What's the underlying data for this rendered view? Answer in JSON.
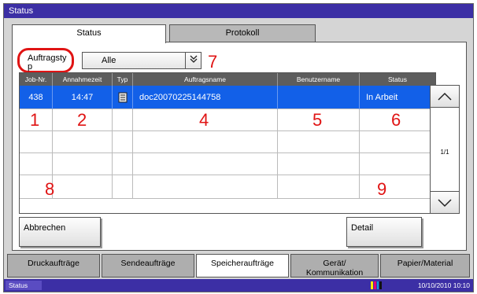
{
  "window": {
    "title": "Status"
  },
  "tabs": [
    {
      "label": "Status",
      "active": true
    },
    {
      "label": "Protokoll",
      "active": false
    }
  ],
  "filter": {
    "label": "Auftragsty\np",
    "value": "Alle",
    "chevron_icon": "double-chevron-down-icon"
  },
  "table": {
    "headers": [
      "Job-Nr.",
      "Annahmezeit",
      "Typ",
      "Auftragsname",
      "Benutzername",
      "Status"
    ],
    "rows": [
      {
        "job": "438",
        "time": "14:47",
        "type_icon": "storage-document-icon",
        "name": "doc20070225144758",
        "user": "",
        "status": "In Arbeit",
        "selected": true
      },
      {
        "job": "",
        "time": "",
        "name": "",
        "user": "",
        "status": ""
      },
      {
        "job": "",
        "time": "",
        "name": "",
        "user": "",
        "status": ""
      },
      {
        "job": "",
        "time": "",
        "name": "",
        "user": "",
        "status": ""
      },
      {
        "job": "",
        "time": "",
        "name": "",
        "user": "",
        "status": ""
      }
    ]
  },
  "callouts": [
    "1",
    "2",
    "4",
    "5",
    "6",
    "7",
    "8",
    "9"
  ],
  "pager": {
    "page": "1/1"
  },
  "buttons": {
    "cancel": "Abbrechen",
    "detail": "Detail"
  },
  "bottom_tabs": [
    {
      "label": "Druckaufträge",
      "active": false
    },
    {
      "label": "Sendeaufträge",
      "active": false
    },
    {
      "label": "Speicheraufträge",
      "active": true
    },
    {
      "label": "Gerät/\nKommunikation",
      "active": false
    },
    {
      "label": "Papier/Material",
      "active": false
    }
  ],
  "statusbar": {
    "label": "Status",
    "datetime": "10/10/2010 10:10"
  },
  "colors": {
    "title_bar": "#3c2fa5",
    "selected_row": "#1260e8",
    "callout": "#e01414"
  }
}
